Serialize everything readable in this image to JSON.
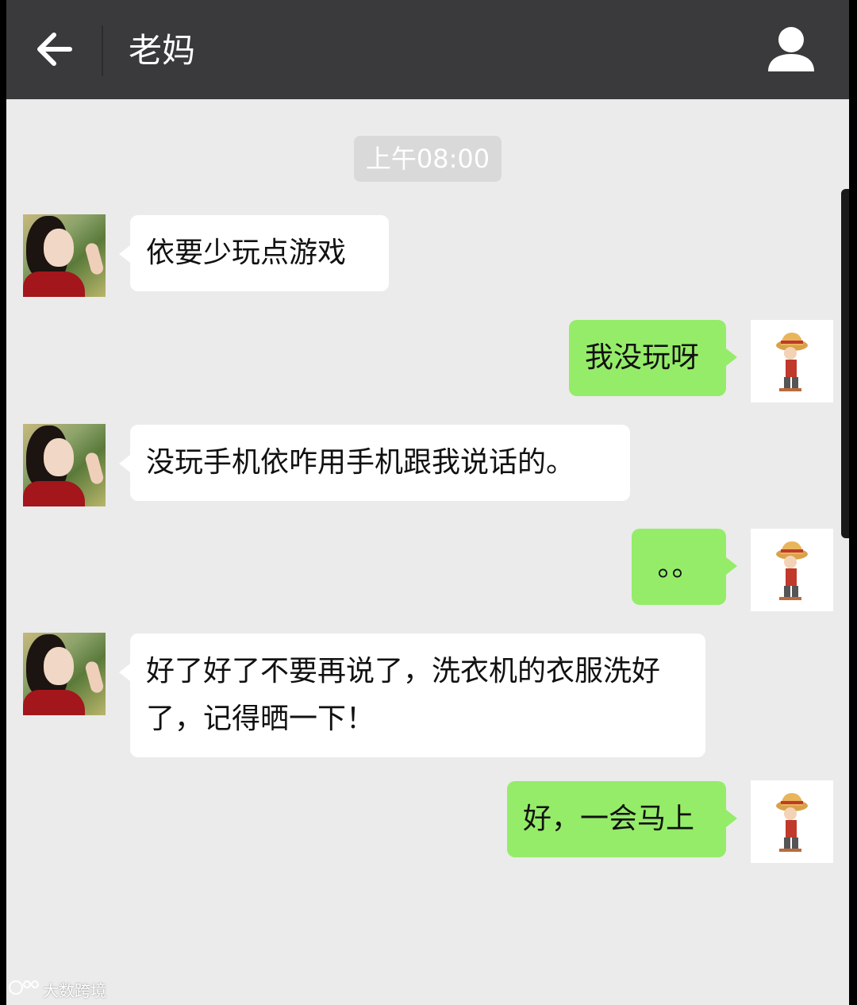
{
  "header": {
    "title": "老妈",
    "back_icon": "back-arrow-icon",
    "profile_icon": "person-icon"
  },
  "chat": {
    "timestamp": "上午08:00",
    "messages": [
      {
        "sender": "mom",
        "text": "依要少玩点游戏"
      },
      {
        "sender": "me",
        "text": "我没玩呀"
      },
      {
        "sender": "mom",
        "text": "没玩手机依咋用手机跟我说话的。"
      },
      {
        "sender": "me",
        "text": "。。"
      },
      {
        "sender": "mom",
        "text": "好了好了不要再说了，洗衣机的衣服洗好了，记得晒一下！"
      },
      {
        "sender": "me",
        "text": "好，一会马上"
      }
    ]
  },
  "watermark": "大数跨境",
  "colors": {
    "titlebar": "#3a3a3c",
    "background": "#ebebeb",
    "my_bubble": "#95ec69",
    "their_bubble": "#ffffff"
  }
}
